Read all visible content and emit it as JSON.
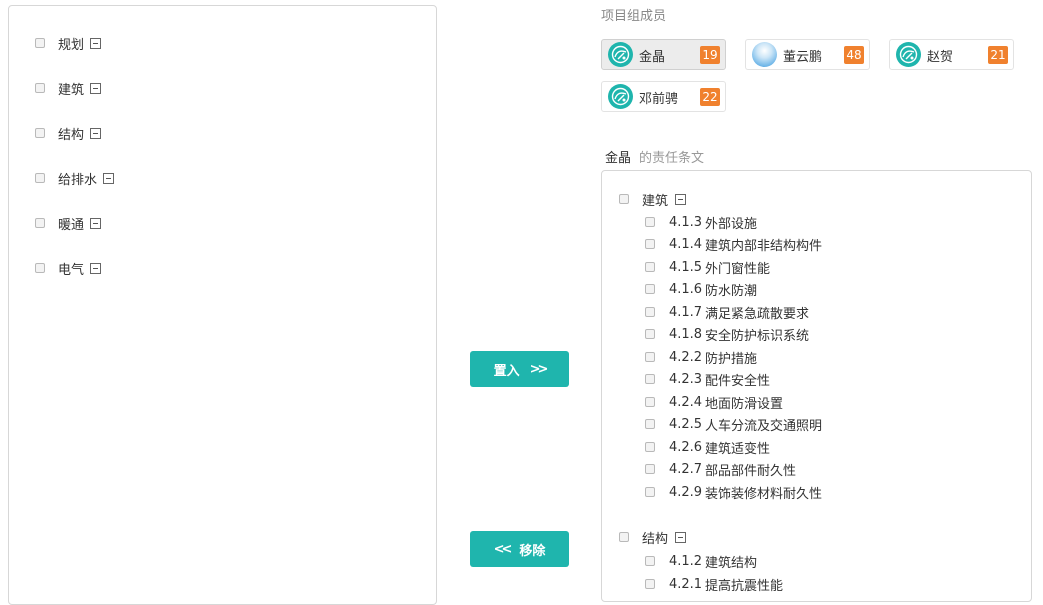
{
  "left_tree": {
    "items": [
      {
        "label": "规划"
      },
      {
        "label": "建筑"
      },
      {
        "label": "结构"
      },
      {
        "label": "给排水"
      },
      {
        "label": "暖通"
      },
      {
        "label": "电气"
      }
    ]
  },
  "actions": {
    "add_label": "置入",
    "add_icon": "chevron-double-right-icon",
    "remove_label": "移除",
    "remove_icon": "chevron-double-left-icon",
    "color": "#1fb5ad"
  },
  "members": {
    "title": "项目组成员",
    "list": [
      {
        "name": "金晶",
        "count": "19",
        "avatar": "default-avatar-icon",
        "selected": true
      },
      {
        "name": "董云鹏",
        "count": "48",
        "avatar": "photo-avatar"
      },
      {
        "name": "赵贺",
        "count": "21",
        "avatar": "default-avatar-icon"
      },
      {
        "name": "邓前骋",
        "count": "22",
        "avatar": "default-avatar-icon"
      }
    ],
    "badge_color": "#f0812e"
  },
  "responsibility": {
    "member_name": "金晶",
    "suffix": "的责任条文",
    "groups": [
      {
        "label": "建筑",
        "items": [
          {
            "code": "4.1.3",
            "name": "外部设施"
          },
          {
            "code": "4.1.4",
            "name": "建筑内部非结构构件"
          },
          {
            "code": "4.1.5",
            "name": "外门窗性能"
          },
          {
            "code": "4.1.6",
            "name": "防水防潮"
          },
          {
            "code": "4.1.7",
            "name": "满足紧急疏散要求"
          },
          {
            "code": "4.1.8",
            "name": "安全防护标识系统"
          },
          {
            "code": "4.2.2",
            "name": "防护措施"
          },
          {
            "code": "4.2.3",
            "name": "配件安全性"
          },
          {
            "code": "4.2.4",
            "name": "地面防滑设置"
          },
          {
            "code": "4.2.5",
            "name": "人车分流及交通照明"
          },
          {
            "code": "4.2.6",
            "name": "建筑适变性"
          },
          {
            "code": "4.2.7",
            "name": "部品部件耐久性"
          },
          {
            "code": "4.2.9",
            "name": "装饰装修材料耐久性"
          }
        ]
      },
      {
        "label": "结构",
        "items": [
          {
            "code": "4.1.2",
            "name": "建筑结构"
          },
          {
            "code": "4.2.1",
            "name": "提高抗震性能"
          }
        ]
      }
    ]
  }
}
